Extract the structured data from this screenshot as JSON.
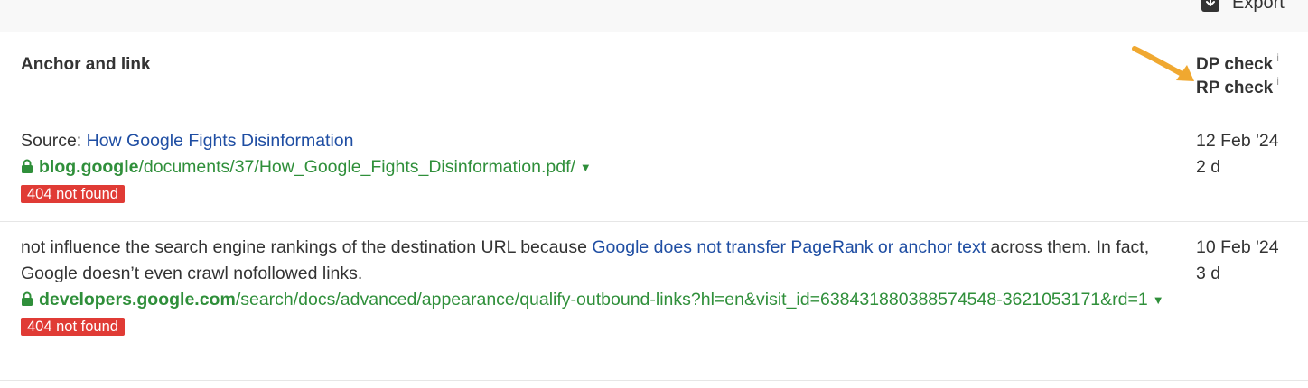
{
  "toolbar": {
    "export_label": "Export",
    "export_icon": "download-icon"
  },
  "columns": {
    "anchor_and_link": "Anchor and link",
    "dp_check": "DP check",
    "rp_check": "RP check",
    "info_marker": "i"
  },
  "annotation": {
    "arrow_color": "#f0a830"
  },
  "rows": [
    {
      "prefix": "Source: ",
      "anchor_text": "How Google Fights Disinformation",
      "url_host": "blog.google",
      "url_path": "/documents/37/How_Google_Fights_Disinformation.pdf/",
      "status": "404 not found",
      "dp_date": "12 Feb '24",
      "rp_age": "2 d"
    },
    {
      "text_before": "not influence the search engine rankings of the destination URL because ",
      "anchor_text": "Google does not transfer PageRank or anchor text",
      "text_after": " across them. In fact, Google doesn’t even crawl nofollowed links.",
      "url_host": "developers.google.com",
      "url_path": "/search/docs/advanced/appearance/qualify-outbound-links?hl=en&visit_id=638431880388574548-3621053171&rd=1",
      "status": "404 not found",
      "dp_date": "10 Feb '24",
      "rp_age": "3 d"
    }
  ],
  "colors": {
    "link_blue": "#1f4ea3",
    "url_green": "#2f8f3a",
    "badge_red": "#e03b35"
  }
}
